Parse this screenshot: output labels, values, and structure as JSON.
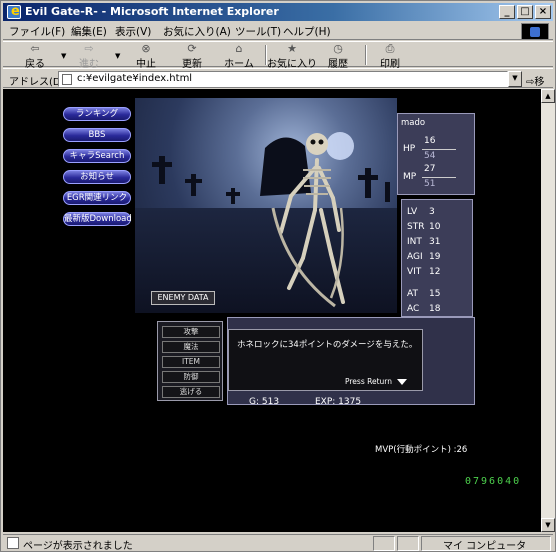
{
  "window": {
    "title": "Evil Gate-R- - Microsoft Internet Explorer",
    "min": "_",
    "max": "□",
    "close": "×"
  },
  "menu": [
    "ファイル(F)",
    "編集(E)",
    "表示(V)",
    "お気に入り(A)",
    "ツール(T)",
    "ヘルプ(H)"
  ],
  "toolbar": {
    "back": "戻る",
    "forward": "進む",
    "stop": "中止",
    "refresh": "更新",
    "home": "ホーム",
    "favorites": "お気に入り",
    "history": "履歴",
    "print": "印刷"
  },
  "address": {
    "label": "アドレス(D)",
    "value": "c:¥evilgate¥index.html",
    "go": "移動"
  },
  "nav": [
    "ランキング",
    "BBS",
    "キャラSearch",
    "お知らせ",
    "EGR関連リンク",
    "最新版Download"
  ],
  "enemy_data_label": "ENEMY DATA",
  "character": {
    "name": "mado",
    "hp_label": "HP",
    "hp": "16",
    "hp_max": "54",
    "mp_label": "MP",
    "mp": "27",
    "mp_max": "51"
  },
  "stats": [
    {
      "label": "LV",
      "value": "3"
    },
    {
      "label": "STR",
      "value": "10"
    },
    {
      "label": "INT",
      "value": "31"
    },
    {
      "label": "AGI",
      "value": "19"
    },
    {
      "label": "VIT",
      "value": "12"
    },
    {
      "label": "AT",
      "value": "15"
    },
    {
      "label": "AC",
      "value": "18"
    }
  ],
  "commands": [
    "攻撃",
    "魔法",
    "ITEM",
    "防御",
    "逃げる"
  ],
  "message": "ホネロックに34ポイントのダメージを与えた。",
  "press_return": "Press Return",
  "gold": "G: 513",
  "exp": "EXP: 1375",
  "mvp": "MVP(行動ポイント) :26",
  "counter": "0796040",
  "status": {
    "text": "ページが表示されました",
    "zone": "マイ コンピュータ"
  },
  "colors": {
    "titlebar": "#0a246a",
    "nav_button": "#2a2a9a",
    "panel": "#3c3d58",
    "counter": "#4dd14d"
  }
}
